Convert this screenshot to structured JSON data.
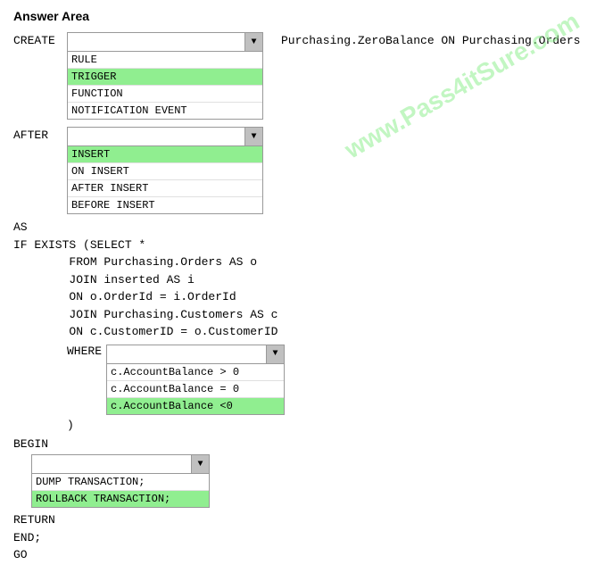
{
  "title": "Answer Area",
  "watermark": "www.Pass4itSure.com",
  "create": {
    "label": "CREATE",
    "options": [
      {
        "text": "RULE",
        "selected": false
      },
      {
        "text": "TRIGGER",
        "selected": true
      },
      {
        "text": "FUNCTION",
        "selected": false
      },
      {
        "text": "NOTIFICATION EVENT",
        "selected": false
      }
    ]
  },
  "right_text": "Purchasing.ZeroBalance ON Purchasing.Orders",
  "after": {
    "label": "AFTER",
    "options": [
      {
        "text": "INSERT",
        "selected": true
      },
      {
        "text": "ON INSERT",
        "selected": false
      },
      {
        "text": "AFTER INSERT",
        "selected": false
      },
      {
        "text": "BEFORE INSERT",
        "selected": false
      }
    ]
  },
  "code": {
    "as_line": "AS",
    "if_exists": "IF EXISTS (SELECT *",
    "from_line": "        FROM Purchasing.Orders AS o",
    "join_inserted": "        JOIN inserted AS i",
    "on_orderid": "        ON o.OrderId = i.OrderId",
    "join_customers": "        JOIN Purchasing.Customers AS c",
    "on_customerid": "        ON c.CustomerID = o.CustomerID"
  },
  "where": {
    "label": "WHERE",
    "options": [
      {
        "text": "c.AccountBalance > 0",
        "selected": false
      },
      {
        "text": "c.AccountBalance = 0",
        "selected": false
      },
      {
        "text": "c.AccountBalance <0",
        "selected": true
      }
    ]
  },
  "close_paren": "        )",
  "begin": {
    "label": "BEGIN",
    "options": [
      {
        "text": "DUMP TRANSACTION;",
        "selected": false
      },
      {
        "text": "ROLLBACK TRANSACTION;",
        "selected": true
      }
    ]
  },
  "footer": {
    "return_line": "RETURN",
    "end_line": "END;",
    "go_line": "GO"
  }
}
